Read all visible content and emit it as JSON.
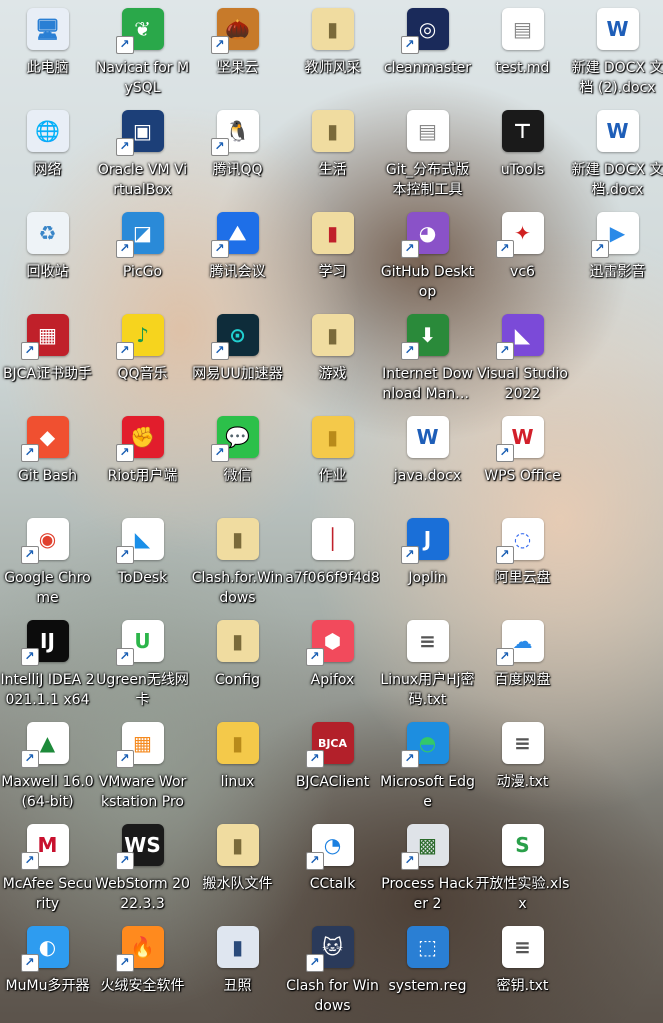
{
  "desktop": {
    "icons": [
      {
        "label": "此电脑",
        "glyph": "🖥",
        "bg": "#e8eef6",
        "fg": "#2a7fd4",
        "shortcut": false
      },
      {
        "label": "网络",
        "glyph": "🌐",
        "bg": "#e8eef6",
        "fg": "#2a7fd4",
        "shortcut": false
      },
      {
        "label": "回收站",
        "glyph": "♻",
        "bg": "#eef3f7",
        "fg": "#3a86c8",
        "shortcut": false
      },
      {
        "label": "BJCA证书助手",
        "glyph": "▦",
        "bg": "#c0202a",
        "fg": "#ffffff",
        "shortcut": true
      },
      {
        "label": "Git Bash",
        "glyph": "◆",
        "bg": "#f05030",
        "fg": "#ffffff",
        "shortcut": true
      },
      {
        "label": "Google Chrome",
        "glyph": "◉",
        "bg": "#ffffff",
        "fg": "#e0402e",
        "shortcut": true
      },
      {
        "label": "IntelliJ IDEA 2021.1.1 x64",
        "glyph": "IJ",
        "bg": "#0c0c0c",
        "fg": "#ffffff",
        "shortcut": true
      },
      {
        "label": "Maxwell 16.0 (64-bit)",
        "glyph": "▲",
        "bg": "#ffffff",
        "fg": "#1d8a3a",
        "shortcut": true
      },
      {
        "label": "McAfee Security",
        "glyph": "M",
        "bg": "#ffffff",
        "fg": "#c8102e",
        "shortcut": true
      },
      {
        "label": "MuMu多开器",
        "glyph": "◐",
        "bg": "#2e9cf0",
        "fg": "#ffffff",
        "shortcut": true
      },
      {
        "label": "Navicat for MySQL",
        "glyph": "❦",
        "bg": "#2aa84a",
        "fg": "#ffffff",
        "shortcut": true
      },
      {
        "label": "Oracle VM VirtualBox",
        "glyph": "▣",
        "bg": "#1c3f78",
        "fg": "#ffffff",
        "shortcut": true
      },
      {
        "label": "PicGo",
        "glyph": "◪",
        "bg": "#2a8ad8",
        "fg": "#ffffff",
        "shortcut": true
      },
      {
        "label": "QQ音乐",
        "glyph": "♪",
        "bg": "#f6d41e",
        "fg": "#1d9a4a",
        "shortcut": true
      },
      {
        "label": "Riot用户端",
        "glyph": "✊",
        "bg": "#e21d2c",
        "fg": "#ffffff",
        "shortcut": true
      },
      {
        "label": "ToDesk",
        "glyph": "◣",
        "bg": "#ffffff",
        "fg": "#1a8fe8",
        "shortcut": true
      },
      {
        "label": "Ugreen无线网卡",
        "glyph": "U",
        "bg": "#ffffff",
        "fg": "#2cb54a",
        "shortcut": true
      },
      {
        "label": "VMware Workstation Pro",
        "glyph": "▦",
        "bg": "#ffffff",
        "fg": "#f58a1f",
        "shortcut": true
      },
      {
        "label": "WebStorm 2022.3.3",
        "glyph": "WS",
        "bg": "#1a1a1a",
        "fg": "#ffffff",
        "shortcut": true
      },
      {
        "label": "火绒安全软件",
        "glyph": "🔥",
        "bg": "#ff8a1e",
        "fg": "#ffffff",
        "shortcut": true
      },
      {
        "label": "坚果云",
        "glyph": "🌰",
        "bg": "#c77a2a",
        "fg": "#ffffff",
        "shortcut": true
      },
      {
        "label": "腾讯QQ",
        "glyph": "🐧",
        "bg": "#ffffff",
        "fg": "#111111",
        "shortcut": true
      },
      {
        "label": "腾讯会议",
        "glyph": "⛰",
        "bg": "#1e6fe8",
        "fg": "#ffffff",
        "shortcut": true
      },
      {
        "label": "网易UU加速器",
        "glyph": "⊙",
        "bg": "#0e2c3a",
        "fg": "#21d0d0",
        "shortcut": true
      },
      {
        "label": "微信",
        "glyph": "💬",
        "bg": "#2cc04a",
        "fg": "#ffffff",
        "shortcut": true
      },
      {
        "label": "Clash.for.Windows",
        "glyph": "▮",
        "bg": "#f0dca0",
        "fg": "#7a6a3a",
        "shortcut": false
      },
      {
        "label": "Config",
        "glyph": "▮",
        "bg": "#f0dca0",
        "fg": "#7a6a3a",
        "shortcut": false
      },
      {
        "label": "linux",
        "glyph": "▮",
        "bg": "#f4c94a",
        "fg": "#b88a1a",
        "shortcut": false
      },
      {
        "label": "搬水队文件",
        "glyph": "▮",
        "bg": "#f0dca0",
        "fg": "#7a6a3a",
        "shortcut": false
      },
      {
        "label": "丑照",
        "glyph": "▮",
        "bg": "#dfe6f0",
        "fg": "#2a4a7a",
        "shortcut": false
      },
      {
        "label": "教师风采",
        "glyph": "▮",
        "bg": "#f0dca0",
        "fg": "#7a6a3a",
        "shortcut": false
      },
      {
        "label": "生活",
        "glyph": "▮",
        "bg": "#f0dca0",
        "fg": "#7a6a3a",
        "shortcut": false
      },
      {
        "label": "学习",
        "glyph": "▮",
        "bg": "#f0dca0",
        "fg": "#c0202a",
        "shortcut": false
      },
      {
        "label": "游戏",
        "glyph": "▮",
        "bg": "#f0dca0",
        "fg": "#7a6a3a",
        "shortcut": false
      },
      {
        "label": "作业",
        "glyph": "▮",
        "bg": "#f4c94a",
        "fg": "#b88a1a",
        "shortcut": false
      },
      {
        "label": "a7f066f9f4d8",
        "glyph": "│",
        "bg": "#ffffff",
        "fg": "#c0202a",
        "shortcut": false
      },
      {
        "label": "Apifox",
        "glyph": "⬢",
        "bg": "#f24a5c",
        "fg": "#ffffff",
        "shortcut": true
      },
      {
        "label": "BJCAClient",
        "glyph": "BJCA",
        "bg": "#b3202a",
        "fg": "#ffffff",
        "shortcut": true
      },
      {
        "label": "CCtalk",
        "glyph": "◔",
        "bg": "#ffffff",
        "fg": "#1a7fe0",
        "shortcut": true
      },
      {
        "label": "Clash for Windows",
        "glyph": "🐱",
        "bg": "#2a3a5a",
        "fg": "#ffffff",
        "shortcut": true
      },
      {
        "label": "cleanmaster",
        "glyph": "◎",
        "bg": "#1a2a5a",
        "fg": "#ffffff",
        "shortcut": true
      },
      {
        "label": "Git_分布式版本控制工具",
        "glyph": "▤",
        "bg": "#ffffff",
        "fg": "#888888",
        "shortcut": false
      },
      {
        "label": "GitHub Desktop",
        "glyph": "◕",
        "bg": "#8a52c8",
        "fg": "#ffffff",
        "shortcut": true
      },
      {
        "label": "Internet Download Manager",
        "glyph": "⬇",
        "bg": "#2a8a3a",
        "fg": "#ffffff",
        "shortcut": true
      },
      {
        "label": "java.docx",
        "glyph": "W",
        "bg": "#ffffff",
        "fg": "#1e5eb8",
        "shortcut": false
      },
      {
        "label": "Joplin",
        "glyph": "J",
        "bg": "#1a6fd8",
        "fg": "#ffffff",
        "shortcut": true
      },
      {
        "label": "Linux用户Hj密码.txt",
        "glyph": "≡",
        "bg": "#ffffff",
        "fg": "#555555",
        "shortcut": false
      },
      {
        "label": "Microsoft Edge",
        "glyph": "◓",
        "bg": "#1d8ee0",
        "fg": "#33c86a",
        "shortcut": true
      },
      {
        "label": "Process Hacker 2",
        "glyph": "▩",
        "bg": "#dfe3e8",
        "fg": "#2a6a2a",
        "shortcut": true
      },
      {
        "label": "system.reg",
        "glyph": "⬚",
        "bg": "#2a7fd4",
        "fg": "#ffffff",
        "shortcut": false
      },
      {
        "label": "test.md",
        "glyph": "▤",
        "bg": "#ffffff",
        "fg": "#888888",
        "shortcut": false
      },
      {
        "label": "uTools",
        "glyph": "⊤",
        "bg": "#1a1a1a",
        "fg": "#ffffff",
        "shortcut": false
      },
      {
        "label": "vc6",
        "glyph": "✦",
        "bg": "#ffffff",
        "fg": "#d02020",
        "shortcut": true
      },
      {
        "label": "Visual Studio 2022",
        "glyph": "◣",
        "bg": "#7b4ad8",
        "fg": "#ffffff",
        "shortcut": true
      },
      {
        "label": "WPS Office",
        "glyph": "W",
        "bg": "#ffffff",
        "fg": "#d21f2a",
        "shortcut": true
      },
      {
        "label": "阿里云盘",
        "glyph": "◌",
        "bg": "#ffffff",
        "fg": "#3a6ef0",
        "shortcut": true
      },
      {
        "label": "百度网盘",
        "glyph": "☁",
        "bg": "#ffffff",
        "fg": "#2a8ae8",
        "shortcut": true
      },
      {
        "label": "动漫.txt",
        "glyph": "≡",
        "bg": "#ffffff",
        "fg": "#555555",
        "shortcut": false
      },
      {
        "label": "开放性实验.xlsx",
        "glyph": "S",
        "bg": "#ffffff",
        "fg": "#2aa04a",
        "shortcut": false
      },
      {
        "label": "密钥.txt",
        "glyph": "≡",
        "bg": "#ffffff",
        "fg": "#555555",
        "shortcut": false
      },
      {
        "label": "新建 DOCX 文档 (2).docx",
        "glyph": "W",
        "bg": "#ffffff",
        "fg": "#1e5eb8",
        "shortcut": false
      },
      {
        "label": "新建 DOCX 文档.docx",
        "glyph": "W",
        "bg": "#ffffff",
        "fg": "#1e5eb8",
        "shortcut": false
      },
      {
        "label": "迅雷影音",
        "glyph": "▶",
        "bg": "#ffffff",
        "fg": "#2a8ae8",
        "shortcut": true
      }
    ]
  }
}
